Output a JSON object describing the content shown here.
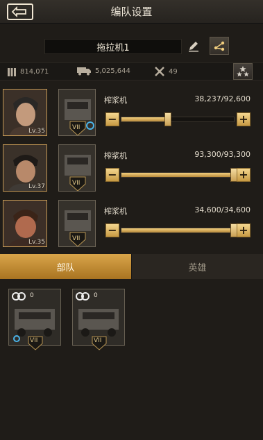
{
  "header": {
    "title": "编队设置"
  },
  "squad": {
    "name": "拖拉机1"
  },
  "stats": {
    "ammo": "814,071",
    "cargo": "5,025,644",
    "tools": "49"
  },
  "rows": [
    {
      "hero_level": "Lv.35",
      "unit_rank": "VII",
      "unit_name": "榨浆机",
      "count": "38,237/92,600",
      "fill": 0.413
    },
    {
      "hero_level": "Lv.37",
      "unit_rank": "VII",
      "unit_name": "榨浆机",
      "count": "93,300/93,300",
      "fill": 1.0
    },
    {
      "hero_level": "Lv.35",
      "unit_rank": "VII",
      "unit_name": "榨浆机",
      "count": "34,600/34,600",
      "fill": 1.0
    }
  ],
  "tabs": [
    {
      "label": "部队",
      "active": true
    },
    {
      "label": "英雄",
      "active": false
    }
  ],
  "cards": [
    {
      "count": "0",
      "rank": "VII"
    },
    {
      "count": "0",
      "rank": "VII"
    }
  ],
  "colors": {
    "accent": "#d9a54a",
    "background": "#1f1c18"
  }
}
